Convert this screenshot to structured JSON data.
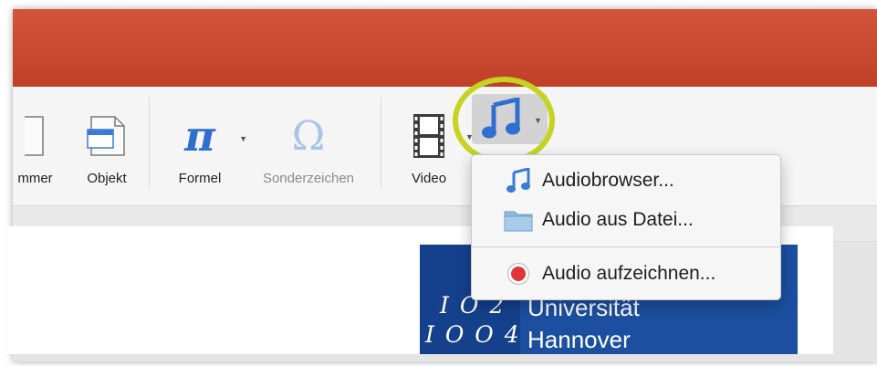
{
  "ribbon": {
    "nummer_label": "mmer",
    "objekt_label": "Objekt",
    "formel_label": "Formel",
    "sonderzeichen_label": "Sonderzeichen",
    "video_label": "Video"
  },
  "audio_menu": {
    "items": [
      {
        "label": "Audiobrowser...",
        "icon": "music-note-icon"
      },
      {
        "label": "Audio aus Datei...",
        "icon": "folder-icon"
      },
      {
        "label": "Audio aufzeichnen...",
        "icon": "record-icon"
      }
    ]
  },
  "logo": {
    "digits_top": "I O 2",
    "digits_bottom": "I O O 4",
    "line1": "Universität",
    "line2": "Hannover"
  },
  "colors": {
    "titlebar": "#c8472d",
    "highlight": "#c7d321",
    "logo_blue": "#1c4fa0",
    "record_red": "#e3343a"
  }
}
